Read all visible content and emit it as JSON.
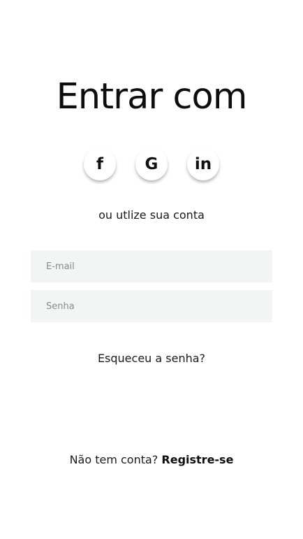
{
  "title": "Entrar com",
  "social": {
    "facebook": "f",
    "google": "G",
    "linkedin": "in"
  },
  "alt_login_text": "ou utlize sua conta",
  "form": {
    "email_placeholder": "E-mail",
    "password_placeholder": "Senha"
  },
  "forgot_password": "Esqueceu a senha?",
  "register": {
    "prompt": "Não tem conta?",
    "link": "Registre-se"
  }
}
